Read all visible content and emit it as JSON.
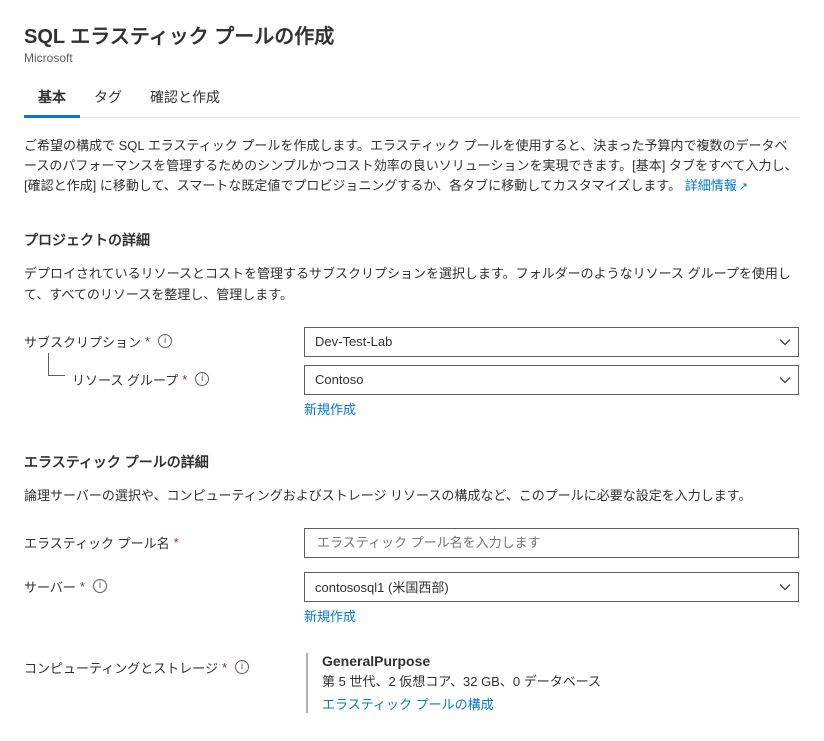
{
  "header": {
    "title": "SQL エラスティック プールの作成",
    "publisher": "Microsoft"
  },
  "tabs": {
    "basic": "基本",
    "tags": "タグ",
    "review": "確認と作成"
  },
  "intro": {
    "text": "ご希望の構成で SQL エラスティック プールを作成します。エラスティック プールを使用すると、決まった予算内で複数のデータベースのパフォーマンスを管理するためのシンプルかつコスト効率の良いソリューションを実現できます。[基本] タブをすべて入力し、[確認と作成] に移動して、スマートな既定値でプロビジョニングするか、各タブに移動してカスタマイズします。",
    "link": "詳細情報"
  },
  "project": {
    "section_title": "プロジェクトの詳細",
    "section_sub": "デプロイされているリソースとコストを管理するサブスクリプションを選択します。フォルダーのようなリソース グループを使用して、すべてのリソースを整理し、管理します。",
    "subscription_label": "サブスクリプション",
    "subscription_value": "Dev-Test-Lab",
    "resource_group_label": "リソース グループ",
    "resource_group_value": "Contoso",
    "create_new": "新規作成"
  },
  "pool": {
    "section_title": "エラスティック プールの詳細",
    "section_sub": "論理サーバーの選択や、コンピューティングおよびストレージ リソースの構成など、このプールに必要な設定を入力します。",
    "name_label": "エラスティック プール名",
    "name_placeholder": "エラスティック プール名を入力します",
    "server_label": "サーバー",
    "server_value": "contososql1 (米国西部)",
    "create_new": "新規作成",
    "compute_label": "コンピューティングとストレージ",
    "compute_tier": "GeneralPurpose",
    "compute_detail": "第 5 世代、2 仮想コア、32 GB、0 データベース",
    "compute_link": "エラスティック プールの構成"
  }
}
